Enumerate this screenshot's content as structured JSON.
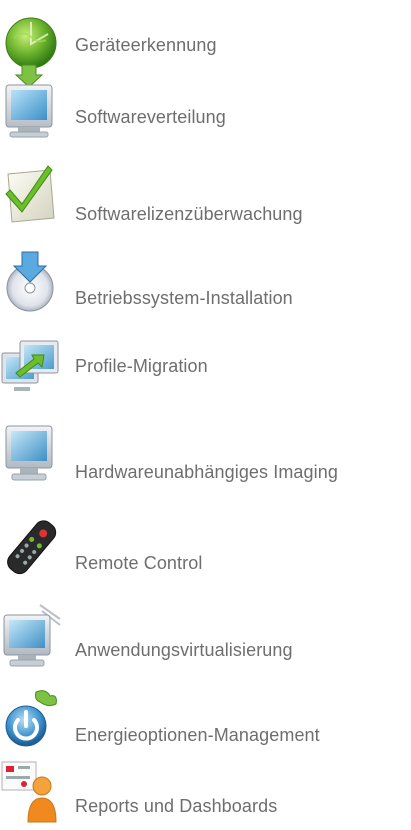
{
  "features": [
    {
      "label": "Geräteerkennung",
      "icon": "globe-check-icon"
    },
    {
      "label": "Softwareverteilung",
      "icon": "monitor-download-icon"
    },
    {
      "label": "Softwarelizenzüberwachung",
      "icon": "license-check-icon"
    },
    {
      "label": "Betriebssystem-Installation",
      "icon": "disc-install-icon"
    },
    {
      "label": "Profile-Migration",
      "icon": "monitor-migration-icon"
    },
    {
      "label": "Hardwareunabhängiges Imaging",
      "icon": "monitor-icon"
    },
    {
      "label": "Remote Control",
      "icon": "remote-control-icon"
    },
    {
      "label": "Anwendungsvirtualisierung",
      "icon": "monitor-virtual-icon"
    },
    {
      "label": "Energieoptionen-Management",
      "icon": "power-leaf-icon"
    },
    {
      "label": "Reports und Dashboards",
      "icon": "reports-person-icon"
    }
  ]
}
